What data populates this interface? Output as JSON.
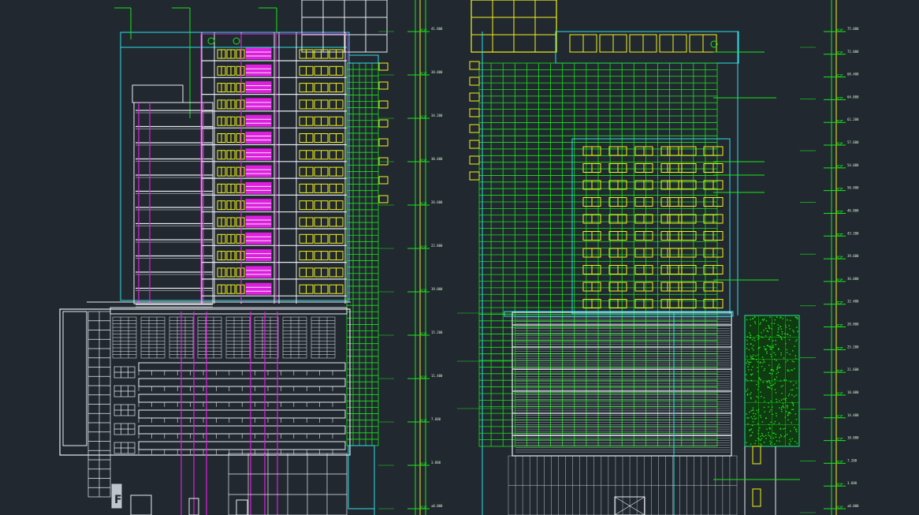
{
  "drawing": {
    "background": "#212830",
    "colors": {
      "white": "#e8ecef",
      "cyan": "#2de1e8",
      "green": "#19e619",
      "yellow": "#f2f21a",
      "magenta": "#e01ee0",
      "green_dim": "#7fe07f"
    },
    "left_elevation_label": "left-building-elevation",
    "right_elevation_label": "right-building-elevation",
    "left_sign_glyph": "F",
    "left_level_marks": [
      "41.800",
      "38.000",
      "34.200",
      "30.400",
      "26.600",
      "22.800",
      "19.000",
      "15.200",
      "11.400",
      "7.600",
      "3.800",
      "±0.000"
    ],
    "right_level_marks": [
      "75.000",
      "72.000",
      "68.400",
      "64.800",
      "61.200",
      "57.600",
      "54.000",
      "50.400",
      "46.800",
      "43.200",
      "39.600",
      "36.000",
      "32.400",
      "28.800",
      "25.200",
      "21.600",
      "18.000",
      "14.400",
      "10.800",
      "7.200",
      "3.600",
      "±0.000"
    ]
  }
}
